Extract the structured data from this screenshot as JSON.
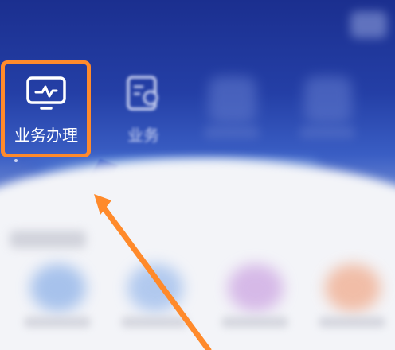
{
  "tiles": [
    {
      "label": "业务办理",
      "icon": "monitor-chart-icon"
    },
    {
      "label": "业务",
      "icon": "document-search-icon"
    }
  ],
  "colors": {
    "highlight": "#ff8a2b",
    "hero": "#243fa6",
    "arrow": "#ff8a2b"
  }
}
